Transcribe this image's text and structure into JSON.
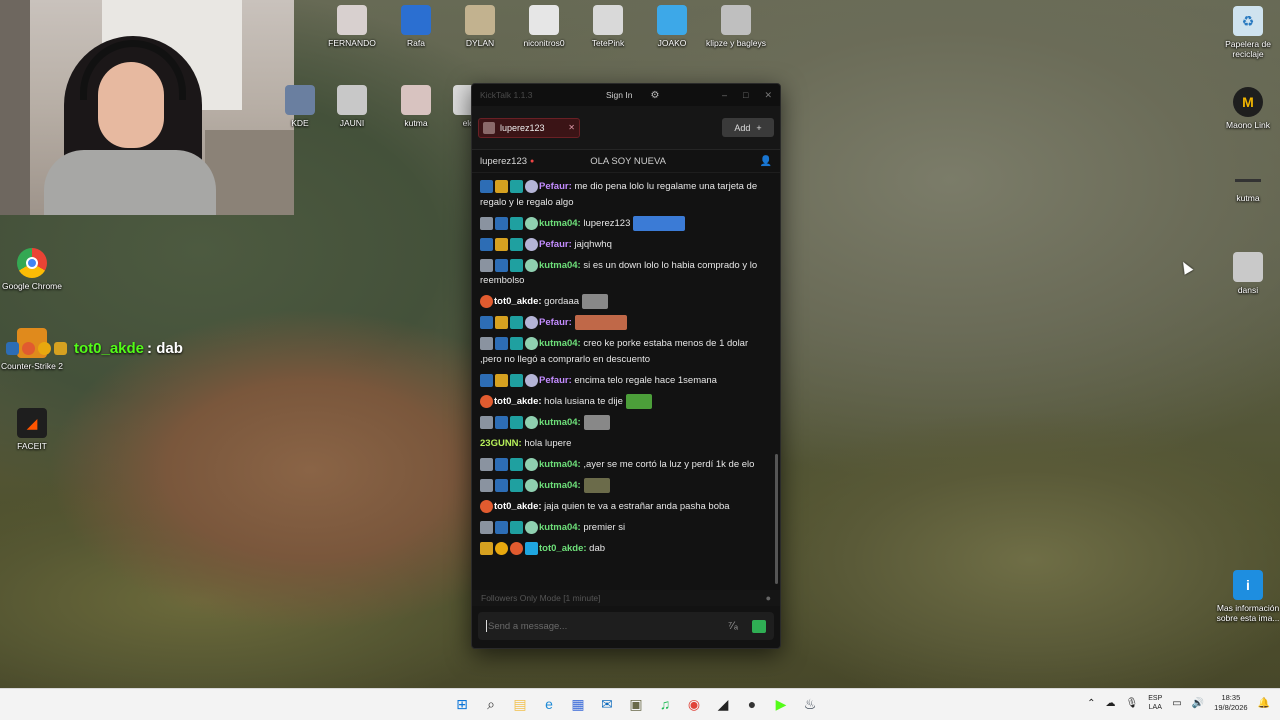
{
  "desktop": {
    "top_icons": [
      {
        "label": "FERNANDO",
        "icon": "cat-photo-icon",
        "color": "#d8d0cf"
      },
      {
        "label": "Rafa",
        "icon": "rocket-league-icon",
        "color": "#2b6fd1"
      },
      {
        "label": "DYLAN",
        "icon": "cat-photo-icon",
        "color": "#c2b28f"
      },
      {
        "label": "niconitros0",
        "icon": "character-icon",
        "color": "#e6e6e6"
      },
      {
        "label": "TetePink",
        "icon": "counter-strike-icon",
        "color": "#d9d9d9"
      },
      {
        "label": "JOAKO",
        "icon": "stumble-guys-icon",
        "color": "#3da8e8"
      },
      {
        "label": "klipze y bagleys",
        "icon": "photo-icon",
        "color": "#bfbfbf"
      }
    ],
    "second_row_icons": [
      {
        "label": "KDE",
        "icon": "photo-icon",
        "color": "#6a7fa0"
      },
      {
        "label": "JAUNI",
        "icon": "cat-photo-icon",
        "color": "#c8c8c8"
      },
      {
        "label": "kutma",
        "icon": "cat-photo-icon",
        "color": "#d8c3c0"
      },
      {
        "label": "elc",
        "icon": "photo-icon",
        "color": "#dddddd"
      }
    ],
    "left_icons": [
      {
        "label": "Google Chrome",
        "icon": "chrome-icon"
      },
      {
        "label": "Counter-Strike 2",
        "icon": "counter-strike-icon"
      },
      {
        "label": "FACEIT",
        "icon": "faceit-icon"
      }
    ],
    "right_icons": [
      {
        "label": "Papelera de reciclaje",
        "icon": "recycle-bin-icon"
      },
      {
        "label": "Maono Link",
        "icon": "maono-link-icon"
      },
      {
        "label": "kutma",
        "icon": "shortcut-icon"
      },
      {
        "label": "dansi",
        "icon": "cat-photo-icon"
      },
      {
        "label": "Mas información sobre esta ima...",
        "icon": "info-icon"
      }
    ],
    "overlay_chat": {
      "user": "tot0_akde",
      "text": ": dab"
    }
  },
  "kicktalk": {
    "app_title": "KickTalk 1.1.3",
    "sign_in": "Sign In",
    "tab_name": "luperez123",
    "add_label": "Add",
    "channel_name": "luperez123",
    "stream_title": "OLA SOY NUEVA",
    "messages": [
      {
        "badges": [
          "b-mod",
          "b-crown",
          "b-sub",
          "b-pfp2"
        ],
        "user": "Pefaur:",
        "uclass": "u-purple",
        "text": " me dio pena lolo lu regalame una tarjeta de regalo y le regalo algo",
        "emote": ""
      },
      {
        "badges": [
          "b-og",
          "b-mod",
          "b-sub",
          "b-pfp"
        ],
        "user": "kutma04:",
        "uclass": "u-green",
        "text": " luperez123",
        "emote": "wide"
      },
      {
        "badges": [
          "b-mod",
          "b-crown",
          "b-sub",
          "b-pfp2"
        ],
        "user": "Pefaur:",
        "uclass": "u-purple",
        "text": " jajqhwhq",
        "emote": ""
      },
      {
        "badges": [
          "b-og",
          "b-mod",
          "b-sub",
          "b-pfp"
        ],
        "user": "kutma04:",
        "uclass": "u-green",
        "text": " si es un down lolo lo habia comprado y lo reembolso",
        "emote": ""
      },
      {
        "badges": [
          "b-fire"
        ],
        "user": "tot0_akde:",
        "uclass": "u-white",
        "text": " gordaaa",
        "emote": "normal"
      },
      {
        "badges": [
          "b-mod",
          "b-crown",
          "b-sub",
          "b-pfp2"
        ],
        "user": "Pefaur:",
        "uclass": "u-purple",
        "text": "",
        "emote": "wide"
      },
      {
        "badges": [
          "b-og",
          "b-mod",
          "b-sub",
          "b-pfp"
        ],
        "user": "kutma04:",
        "uclass": "u-green",
        "text": " creo ke porke estaba menos de 1 dolar ,pero no llegó a comprarlo en descuento",
        "emote": ""
      },
      {
        "badges": [
          "b-mod",
          "b-crown",
          "b-sub",
          "b-pfp2"
        ],
        "user": "Pefaur:",
        "uclass": "u-purple",
        "text": " encima telo regale hace 1semana",
        "emote": ""
      },
      {
        "badges": [
          "b-fire"
        ],
        "user": "tot0_akde:",
        "uclass": "u-white",
        "text": " hola lusiana te dije",
        "emote": "normal"
      },
      {
        "badges": [
          "b-og",
          "b-mod",
          "b-sub",
          "b-pfp"
        ],
        "user": "kutma04:",
        "uclass": "u-green",
        "text": "",
        "emote": "normal"
      },
      {
        "badges": [],
        "user": "23GUNN:",
        "uclass": "u-lime",
        "text": " hola lupere",
        "emote": ""
      },
      {
        "badges": [
          "b-og",
          "b-mod",
          "b-sub",
          "b-pfp"
        ],
        "user": "kutma04:",
        "uclass": "u-green",
        "text": " ,ayer se me cortó la luz y perdí 1k de elo",
        "emote": ""
      },
      {
        "badges": [
          "b-og",
          "b-mod",
          "b-sub",
          "b-pfp"
        ],
        "user": "kutma04:",
        "uclass": "u-green",
        "text": "",
        "emote": "normal"
      },
      {
        "badges": [
          "b-fire"
        ],
        "user": "tot0_akde:",
        "uclass": "u-white",
        "text": " jaja quien te va a estrañar anda pasha boba",
        "emote": ""
      },
      {
        "badges": [
          "b-og",
          "b-mod",
          "b-sub",
          "b-pfp"
        ],
        "user": "kutma04:",
        "uclass": "u-green",
        "text": " premier si",
        "emote": ""
      },
      {
        "badges": [
          "b-crown",
          "b-one",
          "b-fire",
          "b-cube"
        ],
        "user": "tot0_akde:",
        "uclass": "u-green",
        "text": " dab",
        "emote": ""
      }
    ],
    "followers_mode": "Followers Only Mode [1 minute]",
    "input_placeholder": "Send a message..."
  },
  "taskbar": {
    "icons": [
      "windows-start-icon",
      "search-icon",
      "file-explorer-icon",
      "edge-icon",
      "store-icon",
      "outlook-icon",
      "game-icon",
      "spotify-icon",
      "chrome-icon",
      "kick-icon",
      "obs-icon",
      "kick-green-icon",
      "steam-icon"
    ],
    "lang_top": "ESP",
    "lang_bottom": "LAA",
    "time": "18:35",
    "date": "19/8/2026"
  }
}
